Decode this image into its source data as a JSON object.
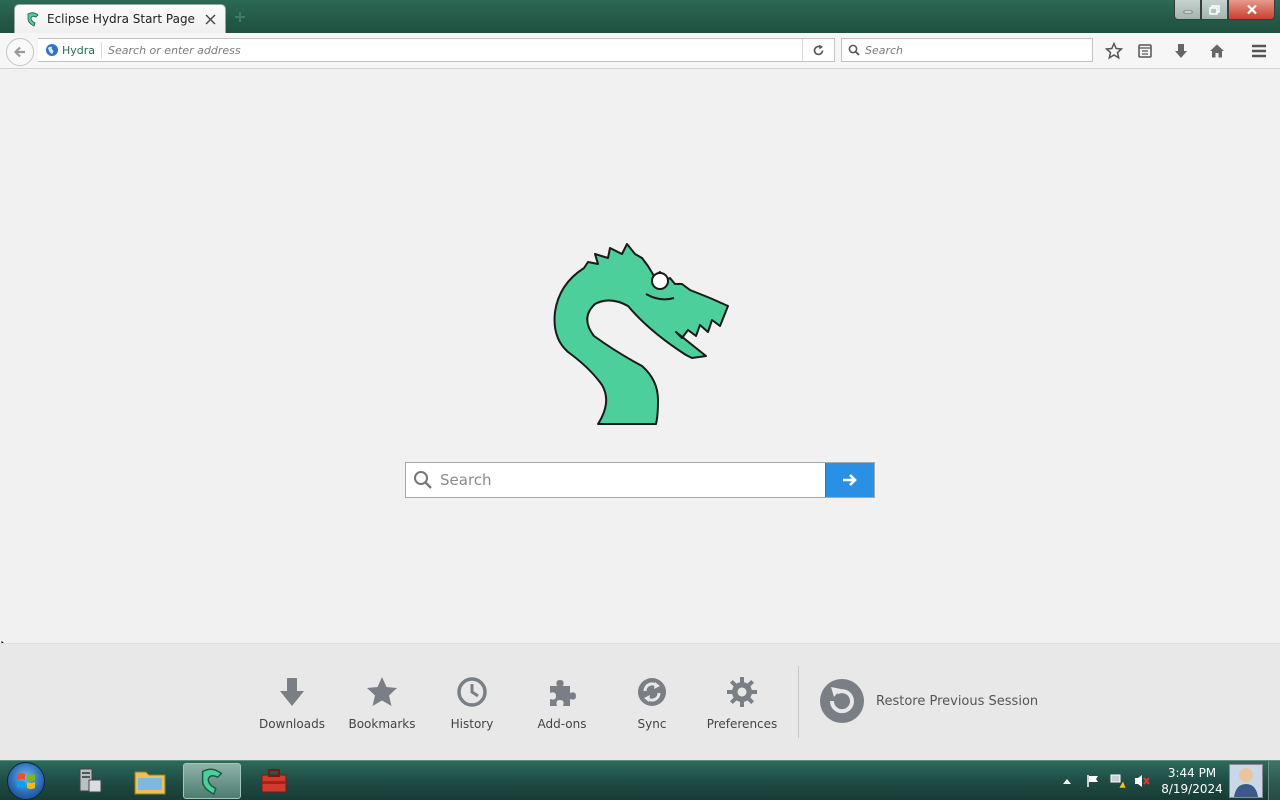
{
  "browser": {
    "tab": {
      "title": "Eclipse Hydra Start Page",
      "favicon": "hydra-icon"
    },
    "identity_label": "Hydra",
    "url": {
      "value": "",
      "placeholder": "Search or enter address"
    },
    "search": {
      "value": "",
      "placeholder": "Search"
    },
    "toolbar_icons": [
      "star-icon",
      "reading-list-icon",
      "download-icon",
      "home-icon",
      "menu-icon"
    ]
  },
  "start_page": {
    "logo": "hydra-dragon-logo",
    "search": {
      "value": "",
      "placeholder": "Search"
    },
    "launcher": [
      {
        "label": "Downloads",
        "icon": "download-icon"
      },
      {
        "label": "Bookmarks",
        "icon": "star-icon"
      },
      {
        "label": "History",
        "icon": "clock-icon"
      },
      {
        "label": "Add-ons",
        "icon": "puzzle-icon"
      },
      {
        "label": "Sync",
        "icon": "sync-icon"
      },
      {
        "label": "Preferences",
        "icon": "gear-icon"
      }
    ],
    "restore_label": "Restore Previous Session"
  },
  "taskbar": {
    "clock": {
      "time": "3:44 PM",
      "date": "8/19/2024"
    },
    "items": [
      "server-manager-icon",
      "file-explorer-icon",
      "hydra-browser-icon",
      "toolbox-icon"
    ]
  },
  "colors": {
    "accent": "#2a90e6",
    "logo_green": "#4ccf9a",
    "titlebar": "#245a48"
  }
}
